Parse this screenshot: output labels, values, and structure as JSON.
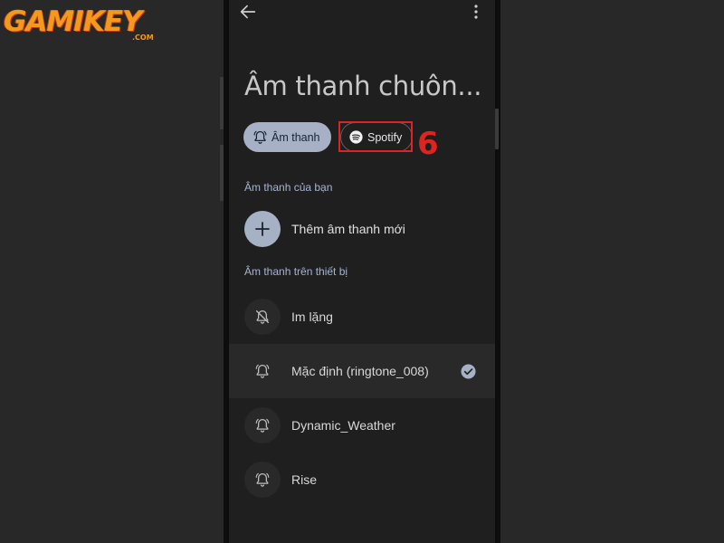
{
  "logo": {
    "main": "GAMIKEY",
    "suffix": ".COM"
  },
  "header": {
    "title": "Âm thanh chuôn..."
  },
  "chips": {
    "sound_label": "Âm thanh",
    "spotify_label": "Spotify"
  },
  "annotation": {
    "step": "6",
    "color": "#e0231e"
  },
  "sections": {
    "yours": "Âm thanh của bạn",
    "device": "Âm thanh trên thiết bị"
  },
  "add_sound": {
    "label": "Thêm âm thanh mới"
  },
  "device_sounds": [
    {
      "label": "Im lặng",
      "icon": "bell-off-icon",
      "selected": false
    },
    {
      "label": "Mặc định (ringtone_008)",
      "icon": "bell-icon",
      "selected": true
    },
    {
      "label": "Dynamic_Weather",
      "icon": "bell-icon",
      "selected": false
    },
    {
      "label": "Rise",
      "icon": "bell-icon",
      "selected": false
    }
  ],
  "colors": {
    "accent": "#a7b1c6",
    "section_header": "#a7b4d2",
    "background": "#1f1f1f",
    "logo": "#f39a1e"
  }
}
